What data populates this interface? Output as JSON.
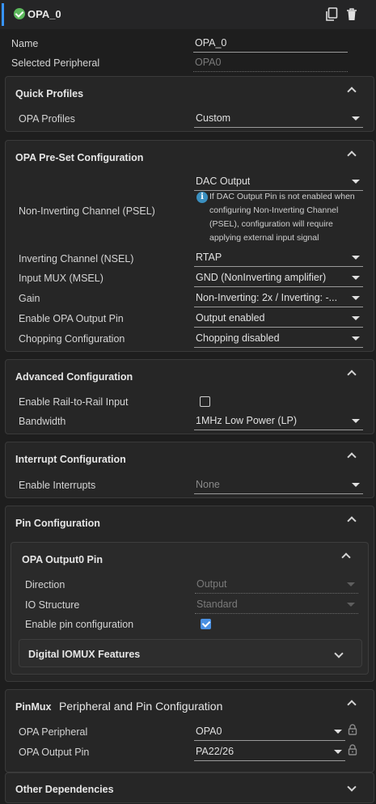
{
  "header": {
    "title": "OPA_0",
    "copy_icon": "copy-icon",
    "delete_icon": "trash-icon"
  },
  "top_fields": {
    "name_label": "Name",
    "name_value": "OPA_0",
    "peripheral_label": "Selected Peripheral",
    "peripheral_value": "OPA0"
  },
  "quick_profiles": {
    "title": "Quick Profiles",
    "opa_profiles_label": "OPA Profiles",
    "opa_profiles_value": "Custom"
  },
  "preset": {
    "title": "OPA Pre-Set Configuration",
    "psel_label": "Non-Inverting Channel (PSEL)",
    "psel_value": "DAC Output",
    "psel_note": "If DAC Output Pin is not enabled when configuring Non-Inverting Channel (PSEL), configuration will require applying external input signal",
    "nsel_label": "Inverting Channel (NSEL)",
    "nsel_value": "RTAP",
    "msel_label": "Input MUX (MSEL)",
    "msel_value": "GND (NonInverting amplifier)",
    "gain_label": "Gain",
    "gain_value": "Non-Inverting: 2x / Inverting: -...",
    "output_pin_label": "Enable OPA Output Pin",
    "output_pin_value": "Output enabled",
    "chopping_label": "Chopping Configuration",
    "chopping_value": "Chopping disabled"
  },
  "advanced": {
    "title": "Advanced Configuration",
    "rail_label": "Enable Rail-to-Rail Input",
    "rail_checked": false,
    "bandwidth_label": "Bandwidth",
    "bandwidth_value": "1MHz Low Power (LP)"
  },
  "interrupt": {
    "title": "Interrupt Configuration",
    "enable_label": "Enable Interrupts",
    "enable_value": "None"
  },
  "pin_config": {
    "title": "Pin Configuration",
    "output0": {
      "title": "OPA Output0 Pin",
      "direction_label": "Direction",
      "direction_value": "Output",
      "io_label": "IO Structure",
      "io_value": "Standard",
      "enable_pin_label": "Enable pin configuration",
      "enable_pin_checked": true
    },
    "iomux_title": "Digital IOMUX Features"
  },
  "pinmux": {
    "tag": "PinMux",
    "title": "Peripheral and Pin Configuration",
    "peripheral_label": "OPA Peripheral",
    "peripheral_value": "OPA0",
    "output_pin_label": "OPA Output Pin",
    "output_pin_value": "PA22/26"
  },
  "other": {
    "title": "Other Dependencies"
  },
  "colors": {
    "accent": "#3794ff",
    "ok": "#5cb85c",
    "checkbox": "#4a90e2",
    "info": "#3a8fbf"
  }
}
